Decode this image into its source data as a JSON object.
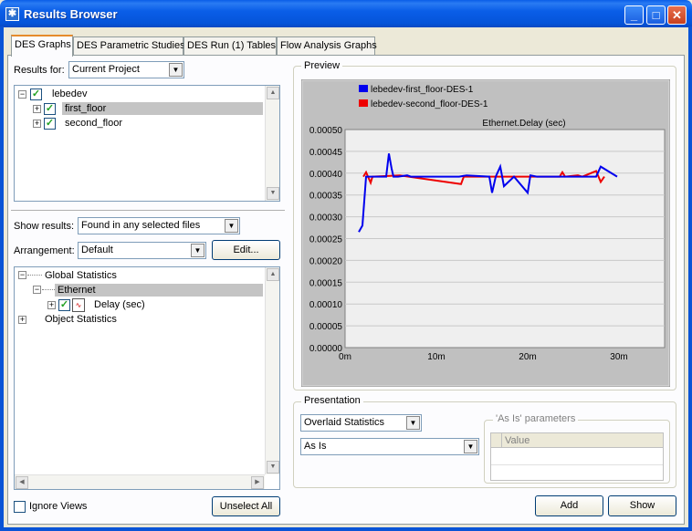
{
  "window": {
    "title": "Results Browser",
    "icon": "results-icon"
  },
  "tabs": [
    {
      "label": "DES Graphs",
      "active": true
    },
    {
      "label": "DES Parametric Studies",
      "active": false
    },
    {
      "label": "DES Run (1) Tables",
      "active": false
    },
    {
      "label": "Flow Analysis Graphs",
      "active": false
    }
  ],
  "left": {
    "results_for_label": "Results for:",
    "results_for_value": "Current Project",
    "project_tree": {
      "root": "lebedev",
      "children": [
        "first_floor",
        "second_floor"
      ],
      "selected": "first_floor"
    },
    "show_results_label": "Show results:",
    "show_results_value": "Found in any selected files",
    "arrangement_label": "Arrangement:",
    "arrangement_value": "Default",
    "edit_button": "Edit...",
    "stats_tree": {
      "global": "Global Statistics",
      "ethernet": "Ethernet",
      "delay": "Delay (sec)",
      "object": "Object Statistics"
    },
    "ignore_views_label": "Ignore Views",
    "unselect_all_button": "Unselect All"
  },
  "preview": {
    "title": "Preview",
    "legend": [
      "lebedev-first_floor-DES-1",
      "lebedev-second_floor-DES-1"
    ],
    "chart_title": "Ethernet.Delay (sec)"
  },
  "presentation": {
    "title": "Presentation",
    "mode_value": "Overlaid Statistics",
    "filter_value": "As Is",
    "params_title": "'As Is' parameters",
    "value_header": "Value"
  },
  "buttons": {
    "add": "Add",
    "show": "Show"
  },
  "colors": {
    "series1": "#0000ee",
    "series2": "#ee0000",
    "plot_bg": "#efefef",
    "frame_bg": "#c0c0c0"
  },
  "chart_data": {
    "type": "line",
    "title": "Ethernet.Delay (sec)",
    "xlabel": "",
    "ylabel": "",
    "x_unit": "minutes",
    "xlim": [
      0,
      30
    ],
    "ylim": [
      0,
      0.0005
    ],
    "xticks": [
      "0m",
      "10m",
      "20m",
      "30m"
    ],
    "yticks": [
      "0.00000",
      "0.00005",
      "0.00010",
      "0.00015",
      "0.00020",
      "0.00025",
      "0.00030",
      "0.00035",
      "0.00040",
      "0.00045",
      "0.00050"
    ],
    "grid": true,
    "legend_position": "top",
    "series": [
      {
        "name": "lebedev-first_floor-DES-1",
        "color": "#0000ee",
        "x": [
          1.5,
          1.9,
          2.3,
          4.5,
          4.8,
          5.1,
          5.3,
          5.8,
          6.8,
          7.2,
          12.5,
          13.3,
          15.8,
          16.1,
          16.5,
          17.0,
          17.4,
          18.5,
          20.0,
          20.3,
          21.0,
          27.5,
          28.0,
          29.8
        ],
        "y": [
          0.000265,
          0.00028,
          0.000392,
          0.000392,
          0.000445,
          0.00041,
          0.000392,
          0.000392,
          0.000395,
          0.000392,
          0.000392,
          0.000395,
          0.000392,
          0.000355,
          0.000392,
          0.000415,
          0.00037,
          0.000392,
          0.000355,
          0.000395,
          0.000392,
          0.000392,
          0.000415,
          0.000392
        ]
      },
      {
        "name": "lebedev-second_floor-DES-1",
        "color": "#ee0000",
        "x": [
          2.0,
          2.3,
          2.8,
          3.0,
          6.0,
          12.7,
          13.0,
          21.5,
          23.5,
          23.8,
          24.1,
          25.5,
          26.0,
          27.5,
          28.0,
          28.4
        ],
        "y": [
          0.000392,
          0.000402,
          0.000378,
          0.000392,
          0.000395,
          0.000375,
          0.000392,
          0.000392,
          0.000392,
          0.000402,
          0.000392,
          0.000395,
          0.000392,
          0.000405,
          0.00038,
          0.000392
        ]
      }
    ]
  }
}
